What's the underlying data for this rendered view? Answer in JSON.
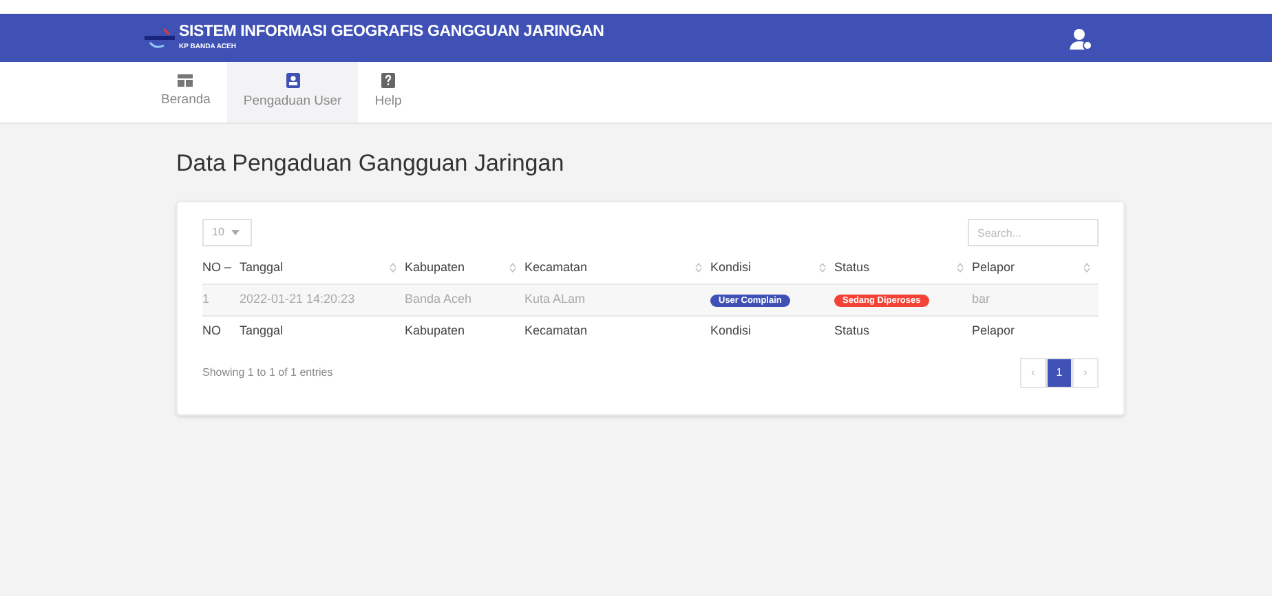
{
  "header": {
    "title": "SISTEM INFORMASI GEOGRAFIS GANGGUAN JARINGAN",
    "subtitle": "KP BANDA ACEH"
  },
  "nav": [
    {
      "label": "Beranda",
      "selected": false
    },
    {
      "label": "Pengaduan User",
      "selected": true
    },
    {
      "label": "Help",
      "selected": false
    }
  ],
  "page_title": "Data Pengaduan Gangguan Jaringan",
  "page_length": "10",
  "search": {
    "placeholder": "Search..."
  },
  "table": {
    "columns": [
      {
        "label": "NO",
        "sorted": true
      },
      {
        "label": "Tanggal",
        "sorted": false
      },
      {
        "label": "Kabupaten",
        "sorted": false
      },
      {
        "label": "Kecamatan",
        "sorted": false
      },
      {
        "label": "Kondisi",
        "sorted": false
      },
      {
        "label": "Status",
        "sorted": false
      },
      {
        "label": "Pelapor",
        "sorted": false
      }
    ],
    "rows": [
      {
        "no": "1",
        "tanggal": "2022-01-21 14:20:23",
        "kabupaten": "Banda Aceh",
        "kecamatan": "Kuta ALam",
        "kondisi": {
          "text": "User Complain",
          "color": "#3f51b5"
        },
        "status": {
          "text": "Sedang Diperoses",
          "color": "#f44336"
        },
        "pelapor": "bar"
      }
    ],
    "footer": [
      "NO",
      "Tanggal",
      "Kabupaten",
      "Kecamatan",
      "Kondisi",
      "Status",
      "Pelapor"
    ]
  },
  "info": "Showing 1 to 1 of 1 entries",
  "pagination": {
    "prev": "‹",
    "pages": [
      {
        "label": "1",
        "selected": true
      }
    ],
    "next": "›"
  }
}
